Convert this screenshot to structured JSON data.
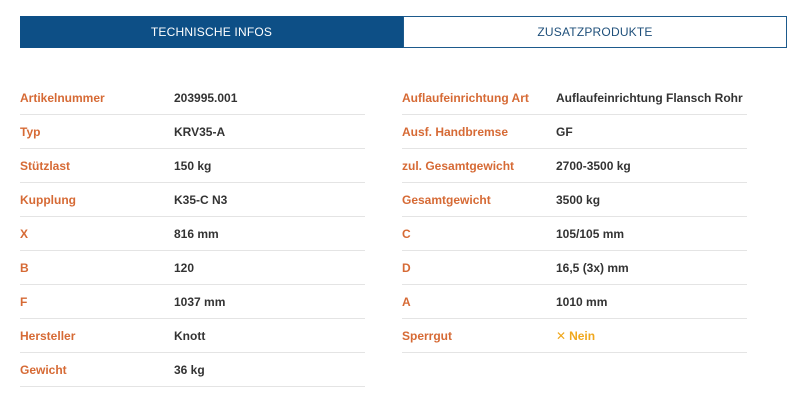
{
  "tabs": {
    "technical": "TECHNISCHE INFOS",
    "accessories": "ZUSATZPRODUKTE"
  },
  "specs_left": [
    {
      "label": "Artikelnummer",
      "value": "203995.001"
    },
    {
      "label": "Typ",
      "value": "KRV35-A"
    },
    {
      "label": "Stützlast",
      "value": "150 kg"
    },
    {
      "label": "Kupplung",
      "value": "K35-C N3"
    },
    {
      "label": "X",
      "value": "816 mm"
    },
    {
      "label": "B",
      "value": "120"
    },
    {
      "label": "F",
      "value": "1037 mm"
    },
    {
      "label": "Hersteller",
      "value": "Knott"
    },
    {
      "label": "Gewicht",
      "value": "36 kg"
    }
  ],
  "specs_right": [
    {
      "label": "Auflaufeinrichtung Art",
      "value": "Auflaufeinrichtung Flansch Rohr"
    },
    {
      "label": "Ausf. Handbremse",
      "value": "GF"
    },
    {
      "label": "zul. Gesamtgewicht",
      "value": "2700-3500 kg"
    },
    {
      "label": "Gesamtgewicht",
      "value": "3500 kg"
    },
    {
      "label": "C",
      "value": "105/105 mm"
    },
    {
      "label": "D",
      "value": "16,5 (3x) mm"
    },
    {
      "label": "A",
      "value": "1010 mm"
    },
    {
      "label": "Sperrgut",
      "value": "Nein",
      "icon": "cross-icon"
    }
  ],
  "colors": {
    "tab_active_bg": "#0d4f86",
    "label": "#d66a35",
    "value": "#333333",
    "status_no": "#f0a81e"
  }
}
